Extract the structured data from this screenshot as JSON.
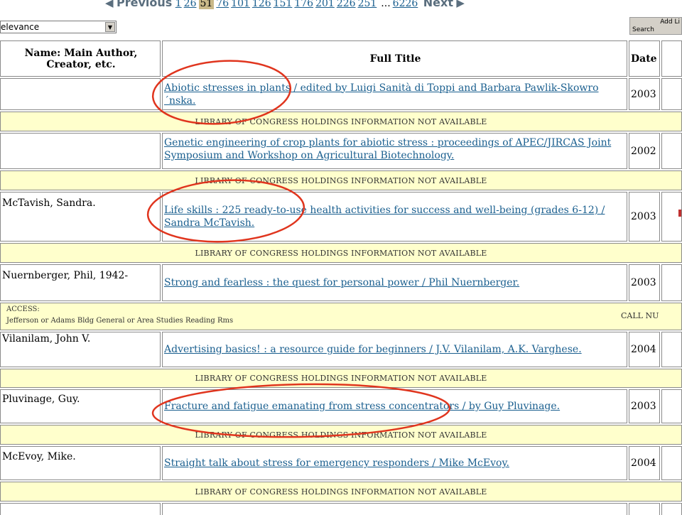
{
  "pager": {
    "prev_arrow": "◀",
    "prev_label": "Previous",
    "pages": [
      "1",
      "26"
    ],
    "current": "51",
    "pages_after": [
      "76",
      "101",
      "126",
      "151",
      "176",
      "201",
      "226",
      "251"
    ],
    "ellipsis": "...",
    "last": "6226",
    "next_label": "Next",
    "next_arrow": "▶"
  },
  "sort": {
    "selected": "elevance",
    "arrow": "▼"
  },
  "add_limits": {
    "line1": "Add Li",
    "line2": "Search"
  },
  "table": {
    "headers": {
      "author": "Name: Main Author, Creator, etc.",
      "title": "Full Title",
      "date": "Date"
    },
    "band_text": "LIBRARY OF CONGRESS HOLDINGS INFORMATION NOT AVAILABLE",
    "access": {
      "label": "ACCESS:",
      "location": "Jefferson or Adams Bldg General or Area Studies Reading Rms",
      "call": "CALL NU"
    },
    "rows": [
      {
        "author": "",
        "title": "Abiotic stresses in plants / edited by Luigi Sanità di Toppi and Barbara Pawlik-Skowro´nska.",
        "date": "2003"
      },
      {
        "author": "",
        "title": "Genetic engineering of crop plants for abiotic stress : proceedings of APEC/JIRCAS Joint Symposium and Workshop on Agricultural Biotechnology.",
        "date": "2002"
      },
      {
        "author": "McTavish, Sandra.",
        "title": "Life skills : 225 ready-to-use health activities for success and well-being (grades 6-12) / Sandra McTavish.",
        "date": "2003"
      },
      {
        "author": "Nuernberger, Phil, 1942-",
        "title": "Strong and fearless : the quest for personal power / Phil Nuernberger.",
        "date": "2003"
      },
      {
        "author": "Vilanilam, John V.",
        "title": "Advertising basics! : a resource guide for beginners / J.V. Vilanilam, A.K. Varghese.",
        "date": "2004"
      },
      {
        "author": "Pluvinage, Guy.",
        "title": "Fracture and fatigue emanating from stress concentrators / by Guy Pluvinage.",
        "date": "2003"
      },
      {
        "author": "McEvoy, Mike.",
        "title": "Straight talk about stress for emergency responders / Mike McEvoy.",
        "date": "2004"
      }
    ]
  },
  "colors": {
    "band": "#ffffcc",
    "link": "#1a5f8f",
    "annotation": "#e0351e",
    "current_page": "#c8b888"
  }
}
